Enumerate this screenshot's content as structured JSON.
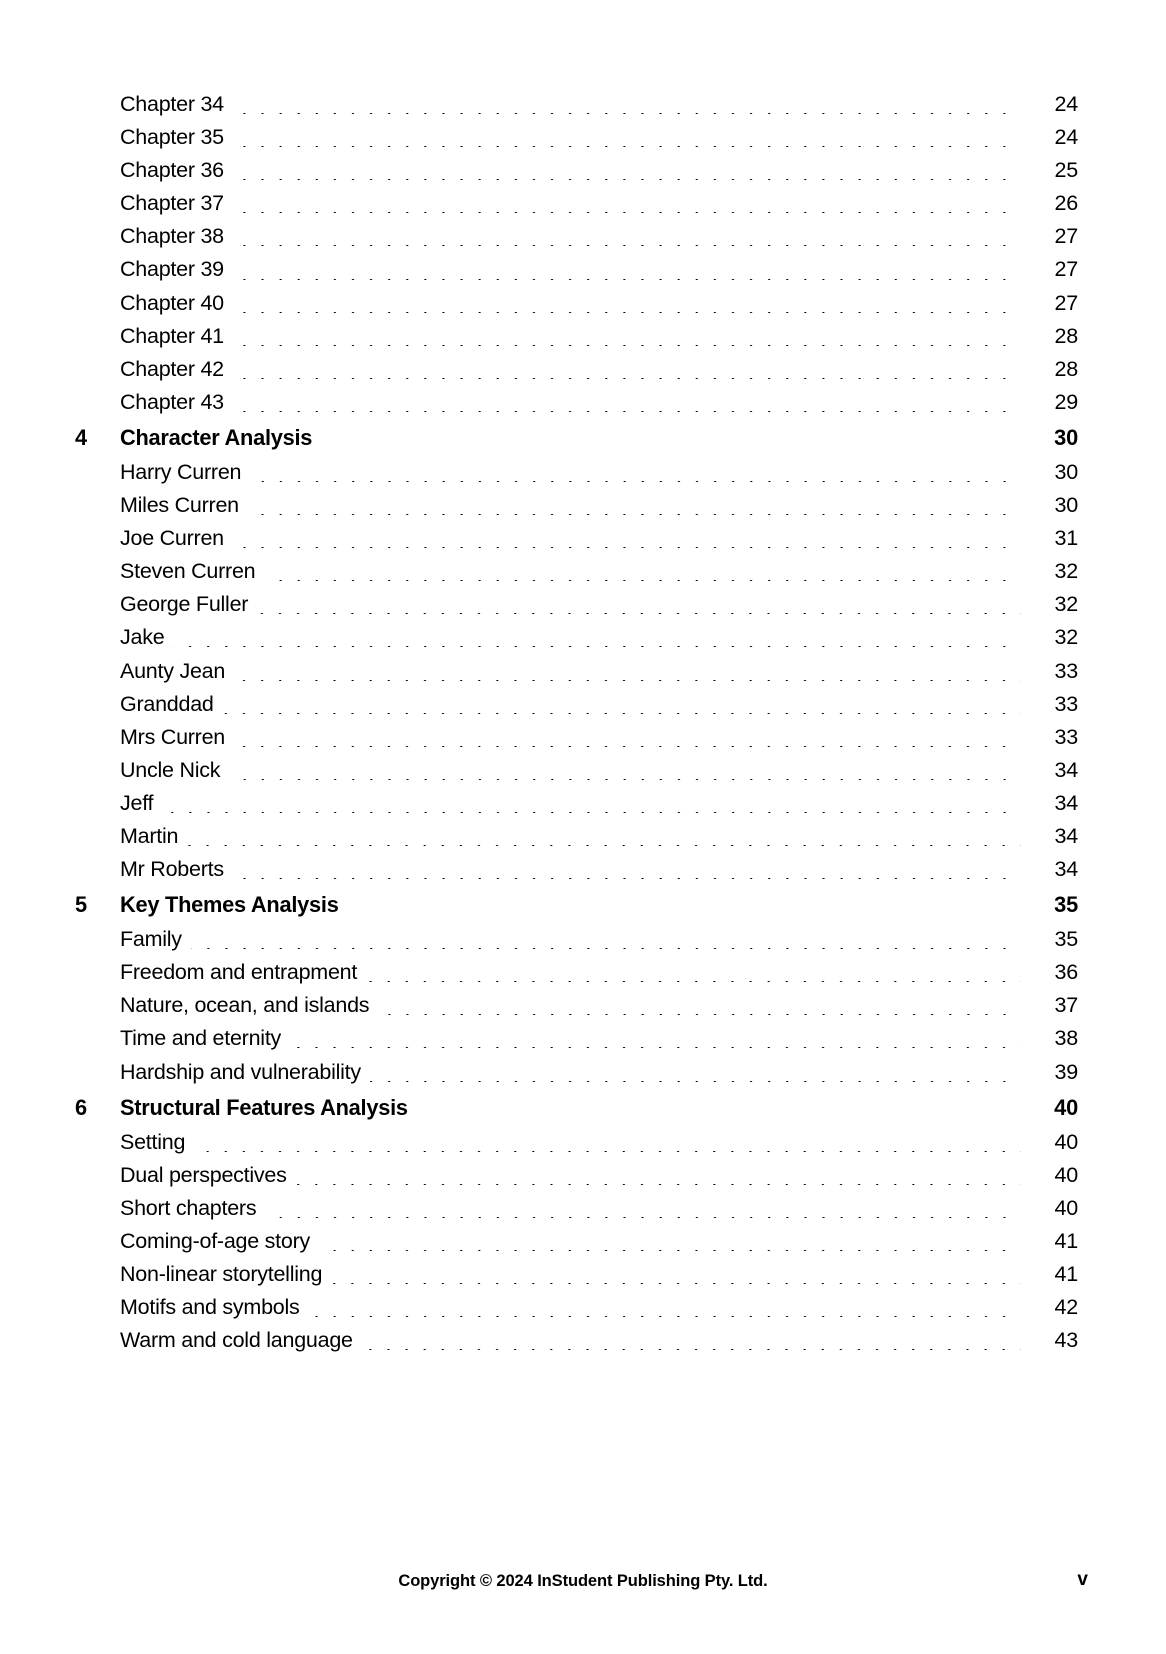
{
  "document": {
    "type": "table-of-contents",
    "page_label": "v"
  },
  "toc": {
    "rows": [
      {
        "num": "",
        "label": "Chapter 34",
        "page": "24",
        "kind": "entry"
      },
      {
        "num": "",
        "label": "Chapter 35",
        "page": "24",
        "kind": "entry"
      },
      {
        "num": "",
        "label": "Chapter 36",
        "page": "25",
        "kind": "entry"
      },
      {
        "num": "",
        "label": "Chapter 37",
        "page": "26",
        "kind": "entry"
      },
      {
        "num": "",
        "label": "Chapter 38",
        "page": "27",
        "kind": "entry"
      },
      {
        "num": "",
        "label": "Chapter 39",
        "page": "27",
        "kind": "entry"
      },
      {
        "num": "",
        "label": "Chapter 40",
        "page": "27",
        "kind": "entry"
      },
      {
        "num": "",
        "label": "Chapter 41",
        "page": "28",
        "kind": "entry"
      },
      {
        "num": "",
        "label": "Chapter 42",
        "page": "28",
        "kind": "entry"
      },
      {
        "num": "",
        "label": "Chapter 43",
        "page": "29",
        "kind": "entry"
      },
      {
        "num": "4",
        "label": "Character Analysis",
        "page": "30",
        "kind": "section"
      },
      {
        "num": "",
        "label": "Harry Curren",
        "page": "30",
        "kind": "entry"
      },
      {
        "num": "",
        "label": "Miles Curren",
        "page": "30",
        "kind": "entry"
      },
      {
        "num": "",
        "label": "Joe Curren",
        "page": "31",
        "kind": "entry"
      },
      {
        "num": "",
        "label": "Steven Curren",
        "page": "32",
        "kind": "entry"
      },
      {
        "num": "",
        "label": "George Fuller",
        "page": "32",
        "kind": "entry"
      },
      {
        "num": "",
        "label": "Jake",
        "page": "32",
        "kind": "entry"
      },
      {
        "num": "",
        "label": "Aunty Jean",
        "page": "33",
        "kind": "entry"
      },
      {
        "num": "",
        "label": "Granddad",
        "page": "33",
        "kind": "entry"
      },
      {
        "num": "",
        "label": "Mrs Curren",
        "page": "33",
        "kind": "entry"
      },
      {
        "num": "",
        "label": "Uncle Nick",
        "page": "34",
        "kind": "entry"
      },
      {
        "num": "",
        "label": "Jeff",
        "page": "34",
        "kind": "entry"
      },
      {
        "num": "",
        "label": "Martin",
        "page": "34",
        "kind": "entry"
      },
      {
        "num": "",
        "label": "Mr Roberts",
        "page": "34",
        "kind": "entry"
      },
      {
        "num": "5",
        "label": "Key Themes Analysis",
        "page": "35",
        "kind": "section"
      },
      {
        "num": "",
        "label": "Family",
        "page": "35",
        "kind": "entry"
      },
      {
        "num": "",
        "label": "Freedom and entrapment",
        "page": "36",
        "kind": "entry"
      },
      {
        "num": "",
        "label": "Nature, ocean, and islands",
        "page": "37",
        "kind": "entry"
      },
      {
        "num": "",
        "label": "Time and eternity",
        "page": "38",
        "kind": "entry"
      },
      {
        "num": "",
        "label": "Hardship and vulnerability",
        "page": "39",
        "kind": "entry"
      },
      {
        "num": "6",
        "label": "Structural Features Analysis",
        "page": "40",
        "kind": "section"
      },
      {
        "num": "",
        "label": "Setting",
        "page": "40",
        "kind": "entry"
      },
      {
        "num": "",
        "label": "Dual perspectives",
        "page": "40",
        "kind": "entry"
      },
      {
        "num": "",
        "label": "Short chapters",
        "page": "40",
        "kind": "entry"
      },
      {
        "num": "",
        "label": "Coming-of-age story",
        "page": "41",
        "kind": "entry"
      },
      {
        "num": "",
        "label": "Non-linear storytelling",
        "page": "41",
        "kind": "entry"
      },
      {
        "num": "",
        "label": "Motifs and symbols",
        "page": "42",
        "kind": "entry"
      },
      {
        "num": "",
        "label": "Warm and cold language",
        "page": "43",
        "kind": "entry"
      }
    ]
  },
  "footer": {
    "copyright": "Copyright © 2024 InStudent Publishing Pty. Ltd.",
    "page_number": "v"
  }
}
